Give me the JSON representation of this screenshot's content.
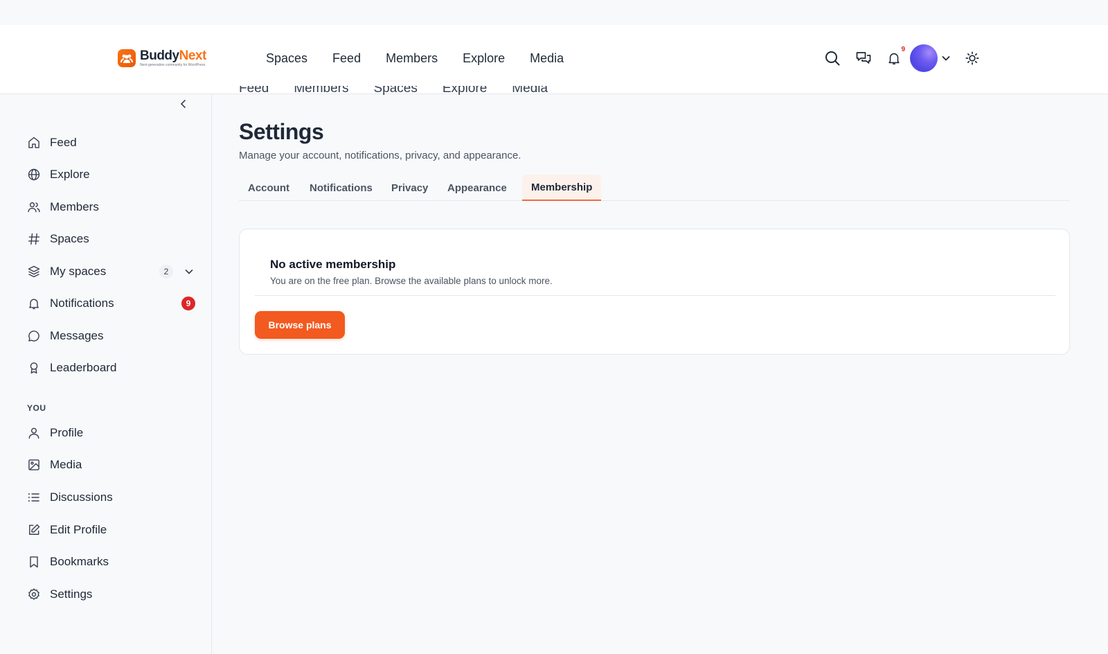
{
  "brand": {
    "name_part1": "Buddy",
    "name_part2": "Next",
    "tagline": "Next-generation community for WordPress",
    "accent": "#f97316"
  },
  "header": {
    "nav": [
      "Spaces",
      "Feed",
      "Members",
      "Explore",
      "Media"
    ],
    "notifications_count": "9",
    "icons": [
      "search-icon",
      "messages-icon",
      "bell-icon",
      "avatar",
      "chevron-down-icon",
      "sun-icon"
    ]
  },
  "sidebar": {
    "items": [
      {
        "label": "Feed",
        "icon": "home-icon"
      },
      {
        "label": "Explore",
        "icon": "globe-icon"
      },
      {
        "label": "Members",
        "icon": "users-icon"
      },
      {
        "label": "Spaces",
        "icon": "hash-icon"
      },
      {
        "label": "My spaces",
        "icon": "layers-icon",
        "count": "2"
      },
      {
        "label": "Notifications",
        "icon": "bell-icon",
        "badge": "9"
      },
      {
        "label": "Messages",
        "icon": "chat-icon"
      },
      {
        "label": "Leaderboard",
        "icon": "award-icon"
      }
    ],
    "section_you": "YOU",
    "you_items": [
      {
        "label": "Profile",
        "icon": "user-icon"
      },
      {
        "label": "Media",
        "icon": "image-icon"
      },
      {
        "label": "Discussions",
        "icon": "list-icon"
      },
      {
        "label": "Edit Profile",
        "icon": "edit-icon"
      },
      {
        "label": "Bookmarks",
        "icon": "bookmark-icon"
      },
      {
        "label": "Settings",
        "icon": "gear-icon"
      }
    ]
  },
  "subnav": [
    "Feed",
    "Members",
    "Spaces",
    "Explore",
    "Media"
  ],
  "page": {
    "title": "Settings",
    "subtitle": "Manage your account, notifications, privacy, and appearance.",
    "tabs": [
      "Account",
      "Notifications",
      "Privacy",
      "Appearance",
      "Membership"
    ],
    "active_tab": "Membership"
  },
  "membership": {
    "title": "No active membership",
    "description": "You are on the free plan. Browse the available plans to unlock more.",
    "button": "Browse plans",
    "button_color": "#f25a1f"
  }
}
